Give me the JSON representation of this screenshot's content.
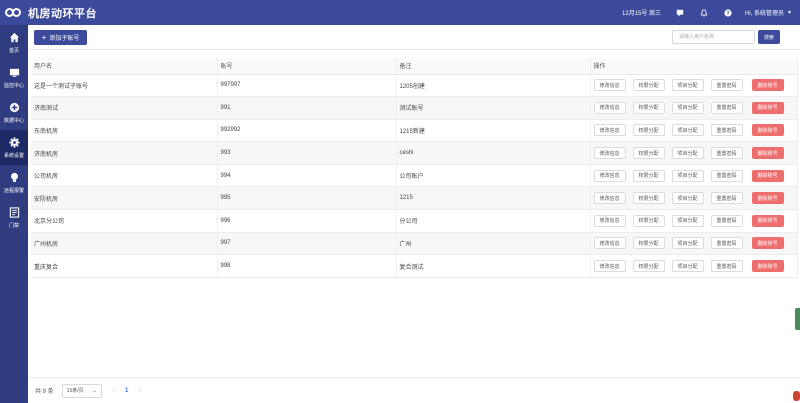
{
  "header": {
    "app_title": "机房动环平台",
    "date": "12月15号 周三",
    "user_greeting": "Hi, 系统管理员",
    "icons": [
      "message-icon",
      "bell-icon",
      "help-icon",
      "user-icon"
    ]
  },
  "sidebar": {
    "items": [
      {
        "label": "首页",
        "icon": "home-icon"
      },
      {
        "label": "监控中心",
        "icon": "monitor-icon"
      },
      {
        "label": "数据中心",
        "icon": "plus-circle-icon"
      },
      {
        "label": "系统设置",
        "icon": "gear-icon",
        "active": true
      },
      {
        "label": "远程报警",
        "icon": "bulb-icon"
      },
      {
        "label": "门禁",
        "icon": "door-icon"
      }
    ]
  },
  "toolbar": {
    "add_label": "添加子账号",
    "search_placeholder": "请输入用户名称",
    "search_label": "搜索"
  },
  "table": {
    "headers": [
      "用户名",
      "账号",
      "备注",
      "操作"
    ],
    "actions": [
      "修改信息",
      "权限分配",
      "项目分配",
      "重置密码",
      "删除账号"
    ],
    "rows": [
      {
        "name": "这是一个测试子账号",
        "account": "997997",
        "note": "1205创建"
      },
      {
        "name": "济南测试",
        "account": "991",
        "note": "测试账号"
      },
      {
        "name": "东南机房",
        "account": "992992",
        "note": "1215新建"
      },
      {
        "name": "济南机房",
        "account": "993",
        "note": "ceshi"
      },
      {
        "name": "公司机房",
        "account": "994",
        "note": "公司账户"
      },
      {
        "name": "安防机房",
        "account": "995",
        "note": "1215"
      },
      {
        "name": "北京分公司",
        "account": "996",
        "note": "分公司"
      },
      {
        "name": "广州机房",
        "account": "997",
        "note": "广州"
      },
      {
        "name": "重庆复合",
        "account": "998",
        "note": "复合测试"
      }
    ]
  },
  "footer": {
    "total": "共 9 条",
    "page_size": "15条/页",
    "current_page": "1"
  },
  "colors": {
    "primary": "#3b4a9b",
    "sidebar": "#2f3c80",
    "danger": "#ee6e6e"
  }
}
